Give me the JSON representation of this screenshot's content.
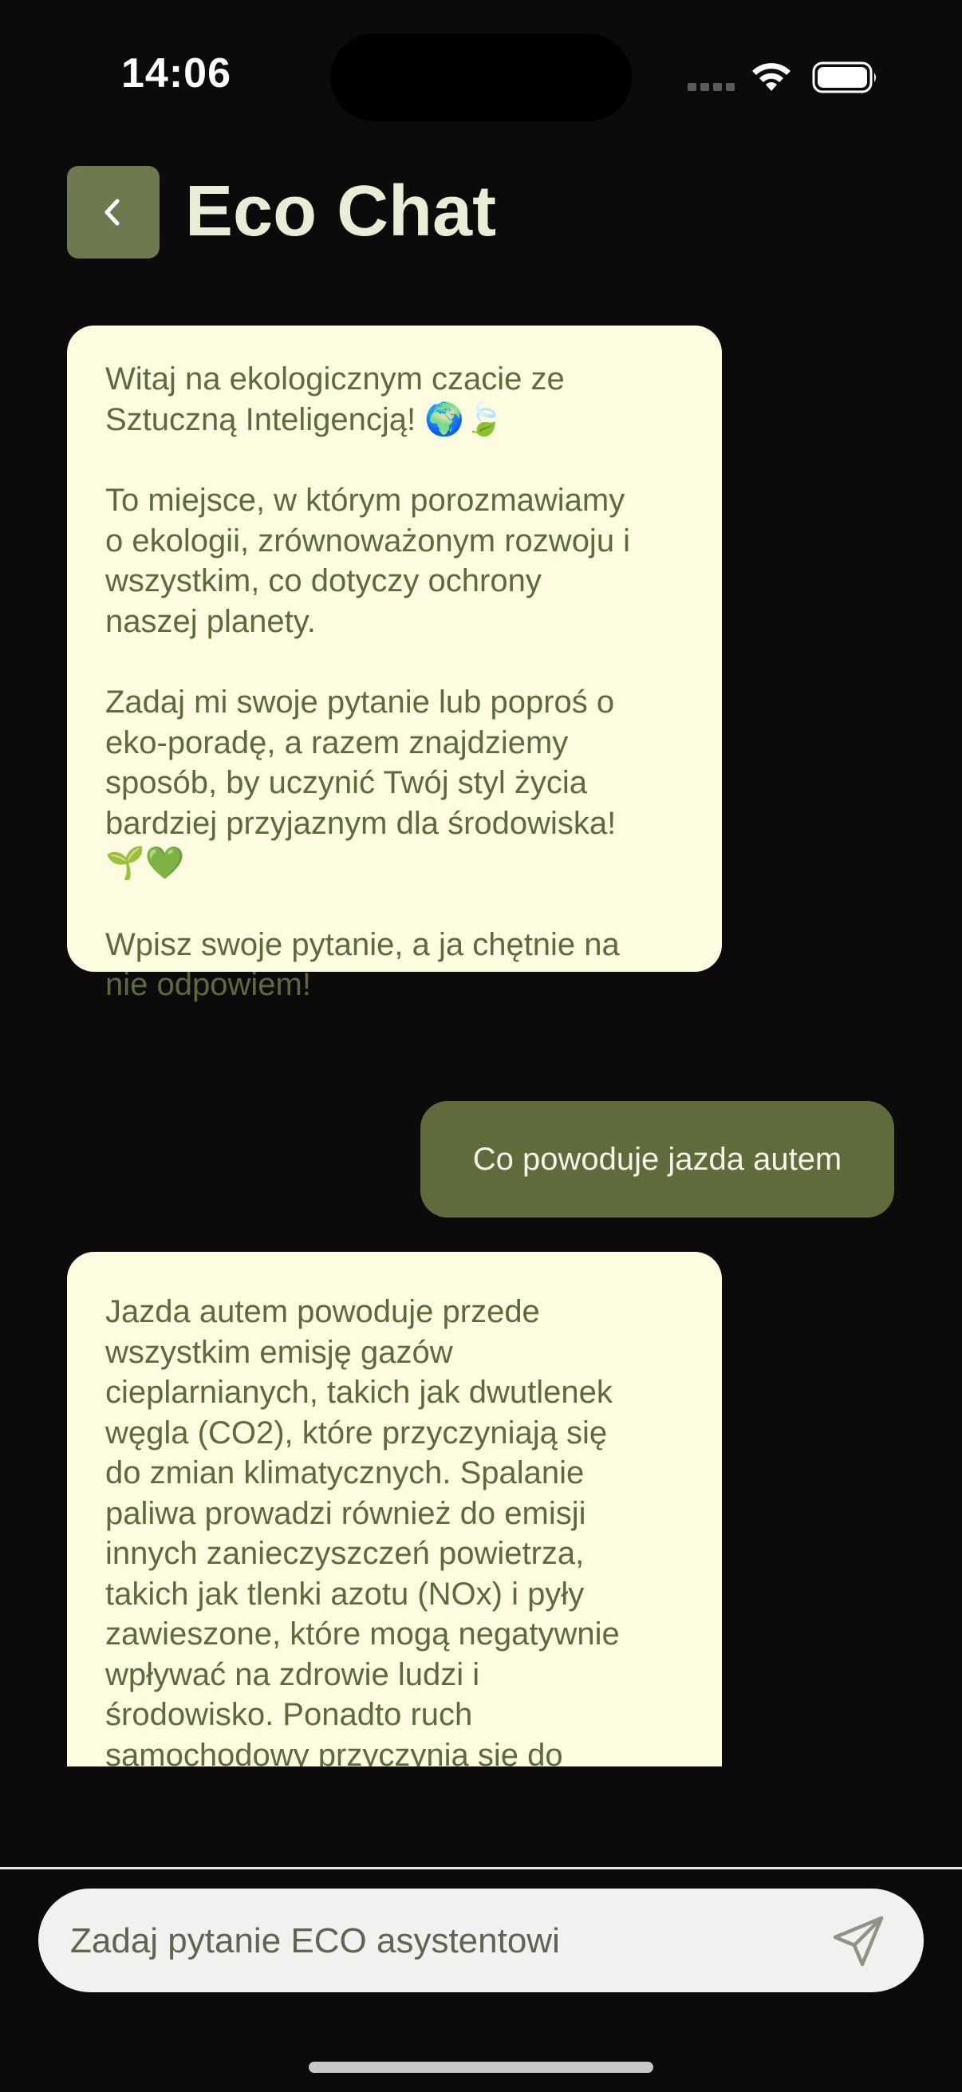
{
  "status_bar": {
    "time": "14:06",
    "icons": [
      "signal-icon",
      "wifi-icon",
      "battery-icon"
    ]
  },
  "header": {
    "back_icon": "chevron-left-icon",
    "title": "Eco Chat"
  },
  "colors": {
    "background": "#0d0a0b",
    "accent": "#6d7a4f",
    "title": "#e6efd6",
    "bot_bubble": "#fdfbe0",
    "bot_text": "#5c6b3a",
    "user_bubble": "#5f6b3a",
    "user_text": "#f4f4ea"
  },
  "messages": [
    {
      "sender": "assistant",
      "paragraphs": [
        "Witaj na ekologicznym czacie ze\nSztuczną Inteligencją! 🌍🍃",
        "To miejsce, w którym porozmawiamy\no ekologii, zrównoważonym rozwoju i\nwszystkim, co dotyczy ochrony\nnaszej planety.",
        "Zadaj mi swoje pytanie lub poproś o\neko-poradę, a razem znajdziemy\nsposób, by uczynić Twój styl życia\nbardziej przyjaznym dla środowiska!\n🌱💚",
        "Wpisz swoje pytanie, a ja chętnie na\nnie odpowiem!"
      ]
    },
    {
      "sender": "user",
      "text": "Co powoduje jazda autem"
    },
    {
      "sender": "assistant",
      "text": "Jazda autem powoduje przede\nwszystkim emisję gazów\ncieplarnianych, takich jak dwutlenek\nwęgla (CO2), które przyczyniają się\ndo zmian klimatycznych. Spalanie\npaliwa prowadzi również do emisji\ninnych zanieczyszczeń powietrza,\ntakich jak tlenki azotu (NOx) i pyły\nzawieszone, które mogą negatywnie\nwpływać na zdrowie ludzi i\nśrodowisko. Ponadto ruch\nsamochodowy przyczynia się do"
    }
  ],
  "composer": {
    "placeholder": "Zadaj pytanie ECO asystentowi",
    "value": "",
    "send_icon": "send-icon"
  }
}
